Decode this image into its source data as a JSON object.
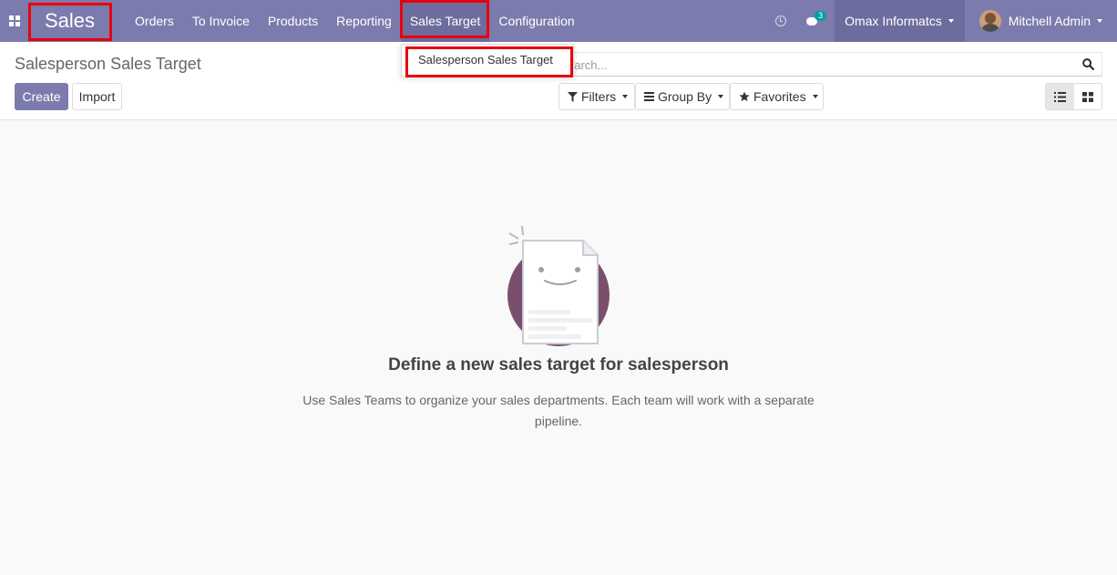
{
  "navbar": {
    "app_name": "Sales",
    "menu": [
      "Orders",
      "To Invoice",
      "Products",
      "Reporting",
      "Sales Target",
      "Configuration"
    ],
    "message_count": "3",
    "company": "Omax Informatcs",
    "user": "Mitchell Admin"
  },
  "dropdown": {
    "items": [
      "Salesperson Sales Target"
    ]
  },
  "control_panel": {
    "title": "Salesperson Sales Target",
    "create_label": "Create",
    "import_label": "Import",
    "search_placeholder": "earch...",
    "filters_label": "Filters",
    "groupby_label": "Group By",
    "favorites_label": "Favorites"
  },
  "empty_state": {
    "title": "Define a new sales target for salesperson",
    "text": "Use Sales Teams to organize your sales departments. Each team will work with a separate pipeline."
  },
  "colors": {
    "navbar": "#7c7bad",
    "active_menu": "#6d6c9e",
    "highlight": "#e8000b",
    "badge": "#00a09d",
    "illustration_circle": "#7a4f6e"
  }
}
